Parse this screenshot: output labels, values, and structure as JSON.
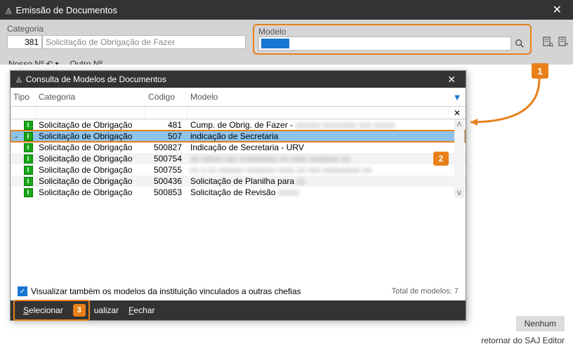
{
  "window": {
    "title": "Emissão de Documentos"
  },
  "toolbar": {
    "categoria_label": "Categoria",
    "categoria_code": "381",
    "categoria_name": "Solicitação de Obrigação de Fazer",
    "modelo_label": "Modelo",
    "nosso_n": "Nosso Nº",
    "outro_n": "Outro Nº"
  },
  "modal": {
    "title": "Consulta de Modelos de Documentos",
    "headers": {
      "tipo": "Tipo",
      "categoria": "Categoria",
      "codigo": "Código",
      "modelo": "Modelo"
    },
    "rows": [
      {
        "categoria": "Solicitação de Obrigação",
        "codigo": "481",
        "modelo": "Cump. de Obrig. de Fazer -",
        "blur_tail": "xxxxxx xxxxxxxx xxx xxxxx"
      },
      {
        "categoria": "Solicitação de Obrigação",
        "codigo": "507",
        "modelo": "indicação de Secretaria",
        "selected": true
      },
      {
        "categoria": "Solicitação de Obrigação",
        "codigo": "500827",
        "modelo": "Indicação de Secretaria - URV"
      },
      {
        "categoria": "Solicitação de Obrigação",
        "codigo": "500754",
        "modelo": "",
        "blur_tail": "xx xxxxx xxx xxxxxxxxx xx xxxx xxxxxxx xx"
      },
      {
        "categoria": "Solicitação de Obrigação",
        "codigo": "500755",
        "modelo": "",
        "blur_tail": "xx x xx xxxxxx xxxxxxx xxxx xx xxx xxxxxxxxx xx"
      },
      {
        "categoria": "Solicitação de Obrigação",
        "codigo": "500436",
        "modelo": "Solicitação de Planilha para",
        "blur_tail": "xx"
      },
      {
        "categoria": "Solicitação de Obrigação",
        "codigo": "500853",
        "modelo": "Solicitação de Revisão",
        "blur_tail": "xxxxx"
      }
    ],
    "checkbox_label": "Visualizar também os modelos da instituição vinculados a outras chefias",
    "total_label": "Total de modelos: 7",
    "btn_selecionar_s": "S",
    "btn_selecionar_rest": "elecionar",
    "btn_visualizar_tail": "ualizar",
    "btn_fechar_f": "F",
    "btn_fechar_rest": "echar"
  },
  "content": {
    "nenhum": "Nenhum",
    "retornar": "retornar do SAJ Editor"
  },
  "steps": {
    "s1": "1",
    "s2": "2",
    "s3": "3"
  }
}
